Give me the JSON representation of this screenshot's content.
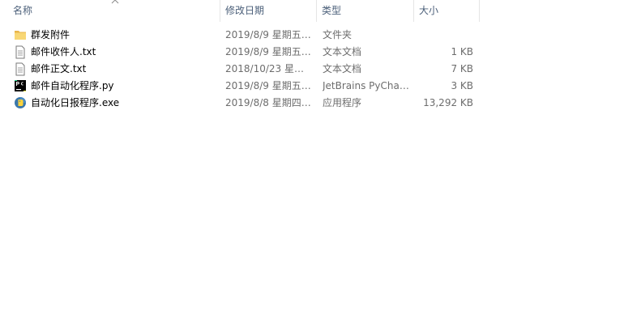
{
  "columns": {
    "name": "名称",
    "date": "修改日期",
    "type": "类型",
    "size": "大小"
  },
  "files": [
    {
      "icon": "folder-icon",
      "name": "群发附件",
      "date": "2019/8/9 星期五 ...",
      "type": "文件夹",
      "size": ""
    },
    {
      "icon": "text-file-icon",
      "name": "邮件收件人.txt",
      "date": "2019/8/9 星期五 ...",
      "type": "文本文档",
      "size": "1 KB"
    },
    {
      "icon": "text-file-icon",
      "name": "邮件正文.txt",
      "date": "2018/10/23 星期...",
      "type": "文本文档",
      "size": "7 KB"
    },
    {
      "icon": "pycharm-file-icon",
      "name": "邮件自动化程序.py",
      "date": "2019/8/9 星期五 ...",
      "type": "JetBrains PyChar...",
      "size": "3 KB"
    },
    {
      "icon": "exe-file-icon",
      "name": "自动化日报程序.exe",
      "date": "2019/8/8 星期四 ...",
      "type": "应用程序",
      "size": "13,292 KB"
    }
  ]
}
